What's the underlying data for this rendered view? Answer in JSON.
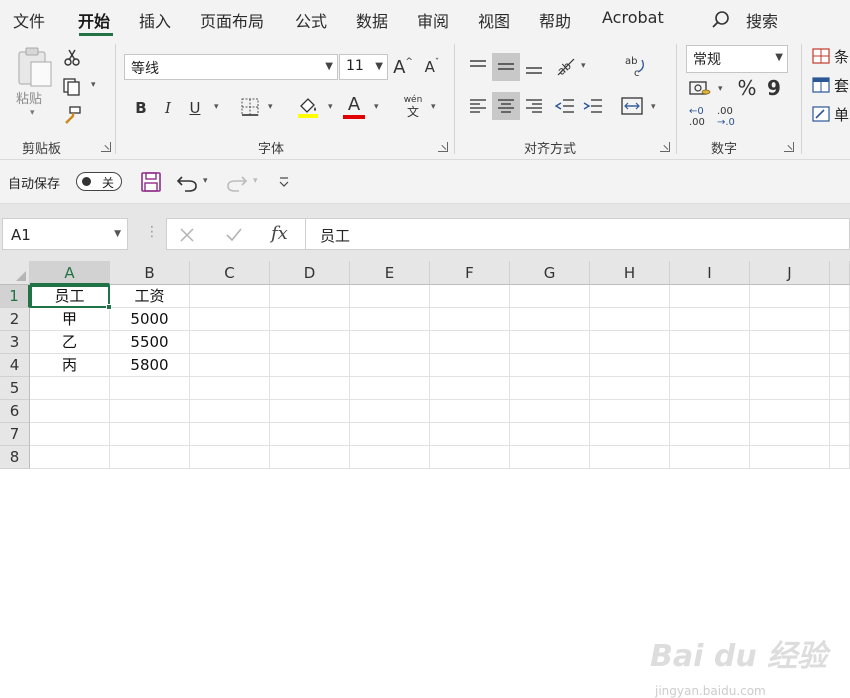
{
  "menu": {
    "items": [
      "文件",
      "开始",
      "插入",
      "页面布局",
      "公式",
      "数据",
      "审阅",
      "视图",
      "帮助",
      "Acrobat"
    ],
    "active": "开始",
    "search_label": "搜索"
  },
  "ribbon": {
    "clipboard": {
      "paste_label": "粘贴",
      "group_label": "剪贴板"
    },
    "font": {
      "font_name": "等线",
      "font_size": "11",
      "grow_label": "A",
      "shrink_label": "A",
      "bold": "B",
      "italic": "I",
      "underline": "U",
      "phonetic_top": "wén",
      "phonetic_bottom": "文",
      "font_color_label": "A",
      "group_label": "字体",
      "highlight_color": "#ffff00",
      "font_color": "#e00000"
    },
    "alignment": {
      "group_label": "对齐方式",
      "wrap_label": "ab c"
    },
    "number": {
      "format": "常规",
      "percent": "%",
      "comma": "9",
      "inc_decimal_top": "←0",
      "inc_decimal_bottom": ".00",
      "dec_decimal_top": ".00",
      "dec_decimal_bottom": "→.0",
      "group_label": "数字"
    },
    "styles": {
      "items": [
        "条",
        "套",
        "单"
      ]
    }
  },
  "qat": {
    "autosave_label": "自动保存",
    "toggle_state": "关"
  },
  "formula_bar": {
    "name_box": "A1",
    "fx": "fx",
    "content": "员工"
  },
  "grid": {
    "columns": [
      "A",
      "B",
      "C",
      "D",
      "E",
      "F",
      "G",
      "H",
      "I",
      "J"
    ],
    "rows": [
      "1",
      "2",
      "3",
      "4",
      "5",
      "6",
      "7",
      "8"
    ],
    "cells": [
      [
        "员工",
        "工资"
      ],
      [
        "甲",
        "5000"
      ],
      [
        "乙",
        "5500"
      ],
      [
        "丙",
        "5800"
      ]
    ]
  },
  "watermark": {
    "brand": "Bai du 经验",
    "url": "jingyan.baidu.com"
  },
  "colors": {
    "accent": "#217346"
  }
}
